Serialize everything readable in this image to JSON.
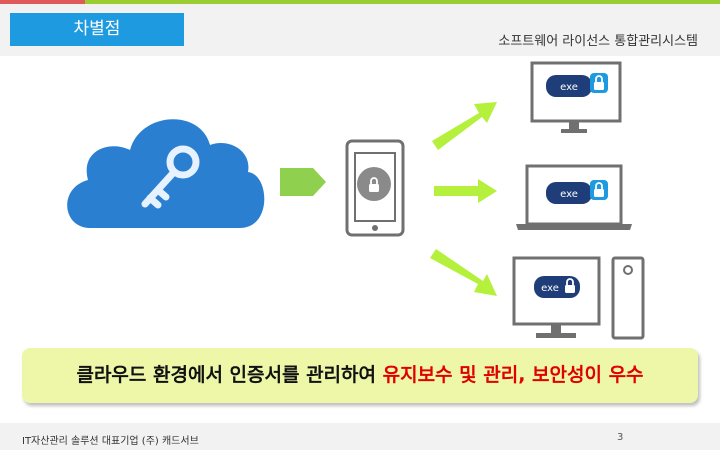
{
  "header": {
    "title": "차별점",
    "subtitle": "소프트웨어 라이선스 통합관리시스템"
  },
  "devices": {
    "exe_label": "exe"
  },
  "banner": {
    "text_normal": "클라우드 환경에서 인증서를 관리하여 ",
    "text_highlight": "유지보수 및 관리, 보안성이 우수"
  },
  "footer": {
    "company": "IT자산관리 솔루션 대표기업  (주) 캐드서브",
    "page": "3"
  },
  "colors": {
    "accent_blue": "#1e9be0",
    "cloud_blue": "#2a7fd0",
    "arrow_green": "#b4f03c",
    "highlight_red": "#e00000",
    "banner_bg": "#eef6a8",
    "badge_navy": "#1f3d78"
  },
  "icons": [
    "cloud-key-icon",
    "phone-lock-icon",
    "monitor-icon",
    "laptop-icon",
    "desktop-tower-icon",
    "lock-icon"
  ]
}
